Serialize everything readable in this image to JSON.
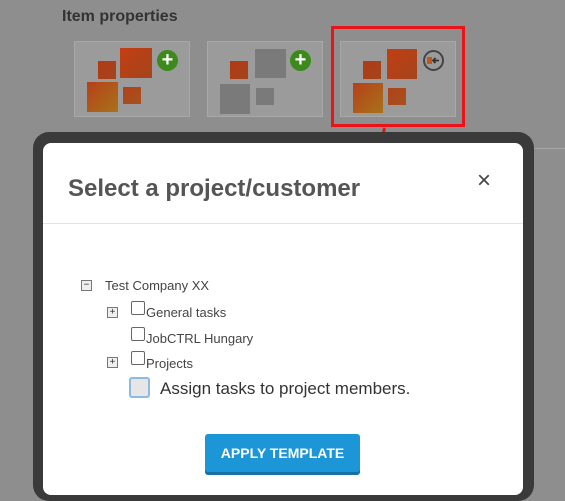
{
  "background": {
    "section_title": "Item properties",
    "tiles": [
      {
        "name": "add-items-option",
        "badge": "+"
      },
      {
        "name": "add-empty-items-option",
        "badge": "+"
      },
      {
        "name": "import-template-option",
        "badge": "import"
      }
    ]
  },
  "modal": {
    "title": "Select a project/customer",
    "close_label": "×",
    "tree": {
      "root": "Test Company XX",
      "children": [
        "General tasks",
        "JobCTRL Hungary",
        "Projects"
      ]
    },
    "assign_label": "Assign tasks to project members.",
    "apply_label": "APPLY TEMPLATE"
  },
  "colors": {
    "highlight": "#e8141a",
    "primary_button": "#1d96d7",
    "badge_green": "#3c8a1c"
  }
}
